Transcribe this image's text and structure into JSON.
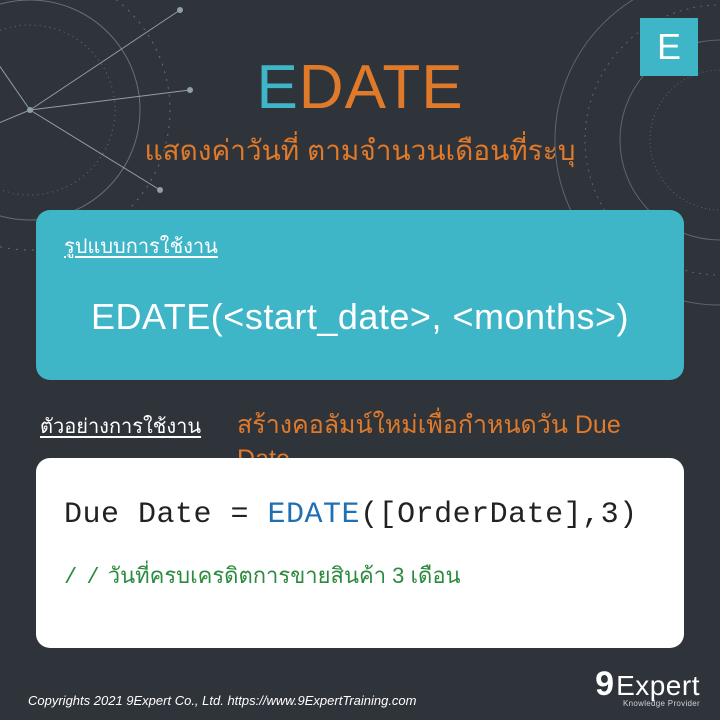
{
  "badge": {
    "letter": "E"
  },
  "title": {
    "accent": "E",
    "main": "DATE"
  },
  "subtitle": "แสดงค่าวันที่ ตามจำนวนเดือนที่ระบุ",
  "usage": {
    "label": "รูปแบบการใช้งาน",
    "syntax": "EDATE(<start_date>, <months>)"
  },
  "example": {
    "label": "ตัวอย่างการใช้งาน",
    "description": "สร้างคอลัมน์ใหม่เพื่อกำหนดวัน Due Date"
  },
  "code": {
    "lhs": "Due Date = ",
    "fn": "EDATE",
    "args": "([OrderDate],3)",
    "comment_prefix": "/ /",
    "comment_text": " วันที่ครบเครดิตการขายสินค้า 3 เดือน"
  },
  "footer": {
    "copyright": "Copyrights 2021 9Expert Co., Ltd.   https://www.9ExpertTraining.com",
    "brand_nine": "9",
    "brand_name": "Expert",
    "brand_tagline": "Knowledge Provider"
  },
  "colors": {
    "bg": "#2f333a",
    "accent": "#3fb5c8",
    "orange": "#e07a2b",
    "code_fn": "#1f6fb2",
    "code_comment": "#2b8a3e"
  }
}
